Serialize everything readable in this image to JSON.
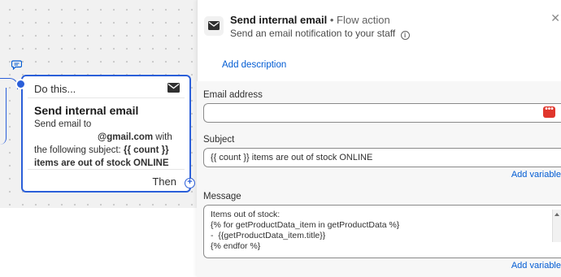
{
  "canvas": {
    "node": {
      "header_label": "Do this...",
      "title": "Send internal email",
      "line1": "Send email to",
      "email_suffix": "@gmail.com",
      "with_text": "with",
      "line3a": "the following subject:",
      "line3b": "{{ count }}",
      "line4": "items are out of stock ONLINE",
      "footer_label": "Then",
      "header_icon": "mail-icon"
    },
    "add_icon": "plus-icon"
  },
  "panel": {
    "title": "Send internal email",
    "separator": "•",
    "type_label": "Flow action",
    "subtitle": "Send an email notification to your staff",
    "add_description_label": "Add description",
    "email_label": "Email address",
    "email_value": "",
    "subject_label": "Subject",
    "subject_value": "{{ count }} items are out of stock ONLINE",
    "add_variable_label": "Add variable",
    "message_label": "Message",
    "message_value": "Items out of stock:\n{% for getProductData_item in getProductData %}\n-  {{getProductData_item.title}}\n{% endfor %}",
    "add_variable_label_2": "Add variable",
    "colors": {
      "accent": "#2b5fd9",
      "link": "#005bd3",
      "error_badge": "#e0362c"
    }
  }
}
